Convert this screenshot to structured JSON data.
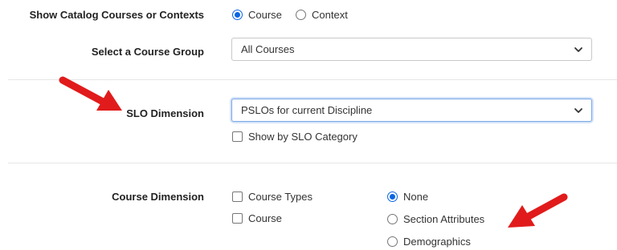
{
  "catalog": {
    "label": "Show Catalog Courses or Contexts",
    "options": [
      {
        "label": "Course",
        "selected": true
      },
      {
        "label": "Context",
        "selected": false
      }
    ]
  },
  "course_group": {
    "label": "Select a Course Group",
    "value": "All Courses"
  },
  "slo_dimension": {
    "label": "SLO Dimension",
    "value": "PSLOs for current Discipline",
    "checkbox_label": "Show by SLO Category"
  },
  "course_dimension": {
    "label": "Course Dimension",
    "checkboxes": [
      {
        "label": "Course Types",
        "checked": false
      },
      {
        "label": "Course",
        "checked": false
      }
    ],
    "radios": [
      {
        "label": "None",
        "selected": true
      },
      {
        "label": "Section Attributes",
        "selected": false
      },
      {
        "label": "Demographics",
        "selected": false
      }
    ]
  },
  "colors": {
    "accent": "#0a66e4",
    "arrow": "#e11b1b"
  },
  "icons": [
    "chevron-down-icon",
    "red-arrow-annotation"
  ]
}
